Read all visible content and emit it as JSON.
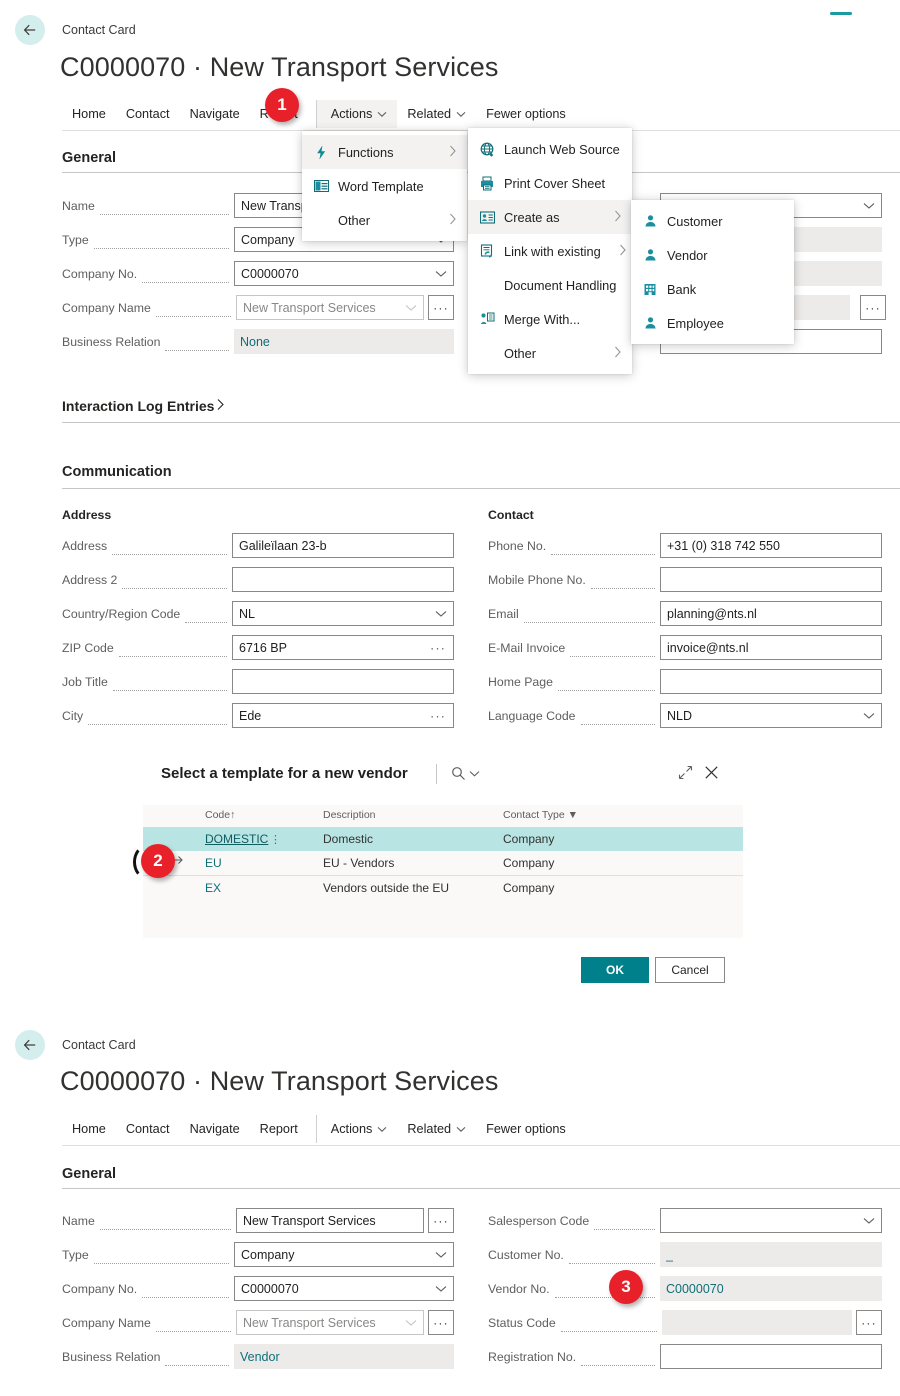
{
  "card_top": {
    "breadcrumb": "Contact Card",
    "title": "C0000070 · New Transport Services",
    "back_icon": "back-arrow-icon",
    "menu": [
      {
        "label": "Home"
      },
      {
        "label": "Contact"
      },
      {
        "label": "Navigate"
      },
      {
        "label": "Report"
      },
      {
        "label": "Actions",
        "caret": "⌄"
      },
      {
        "label": "Related",
        "caret": "⌄"
      },
      {
        "label": "Fewer options"
      }
    ],
    "general_heading": "General",
    "interaction_log_link": "Interaction Log Entries",
    "communication_heading": "Communication",
    "address_subhead": "Address",
    "contact_subhead": "Contact",
    "fields_left": [
      {
        "label": "Name",
        "value": "New Transport Services",
        "kind": "text"
      },
      {
        "label": "Type",
        "value": "Company",
        "kind": "dropdown"
      },
      {
        "label": "Company No.",
        "value": "C0000070",
        "kind": "dropdown"
      },
      {
        "label": "Company Name",
        "value": "New Transport Services",
        "kind": "ghost-dropdown-ellipsis"
      },
      {
        "label": "Business Relation",
        "value": "None",
        "kind": "readonly"
      }
    ],
    "address_fields": [
      {
        "label": "Address",
        "value": "Galileïlaan 23-b",
        "kind": "text"
      },
      {
        "label": "Address 2",
        "value": "",
        "kind": "text"
      },
      {
        "label": "Country/Region Code",
        "value": "NL",
        "kind": "dropdown"
      },
      {
        "label": "ZIP Code",
        "value": "6716 BP",
        "kind": "ellipsis"
      },
      {
        "label": "Job Title",
        "value": "",
        "kind": "text"
      },
      {
        "label": "City",
        "value": "Ede",
        "kind": "ellipsis"
      }
    ],
    "contact_fields": [
      {
        "label": "Phone No.",
        "value": "+31 (0) 318 742 550",
        "kind": "text"
      },
      {
        "label": "Mobile Phone No.",
        "value": "",
        "kind": "text"
      },
      {
        "label": "Email",
        "value": "planning@nts.nl",
        "kind": "text"
      },
      {
        "label": "E-Mail Invoice",
        "value": "invoice@nts.nl",
        "kind": "text"
      },
      {
        "label": "Home Page",
        "value": "",
        "kind": "text"
      },
      {
        "label": "Language Code",
        "value": "NLD",
        "kind": "dropdown"
      }
    ],
    "right_fields_hidden": [
      {
        "value": "",
        "kind": "dropdown"
      },
      {
        "value": "",
        "kind": "readonly"
      },
      {
        "value": "",
        "kind": "readonly"
      },
      {
        "value": "",
        "kind": "readonly-ellipsis"
      },
      {
        "value": "",
        "kind": "text"
      }
    ]
  },
  "actions_menu": {
    "items": [
      {
        "label": "Functions",
        "icon": "lightning-icon",
        "arrow": "›",
        "selected": true
      },
      {
        "label": "Word Template",
        "icon": "word-doc-icon",
        "arrow": ""
      },
      {
        "label": "Other",
        "icon": "",
        "arrow": "›"
      }
    ]
  },
  "functions_menu": {
    "items": [
      {
        "label": "Launch Web Source",
        "icon": "globe-icon",
        "arrow": ""
      },
      {
        "label": "Print Cover Sheet",
        "icon": "printer-icon",
        "arrow": ""
      },
      {
        "label": "Create as",
        "icon": "contact-card-icon",
        "arrow": "›",
        "selected": true
      },
      {
        "label": "Link with existing",
        "icon": "link-icon",
        "arrow": "›"
      },
      {
        "label": "Document Handling",
        "icon": "",
        "arrow": ""
      },
      {
        "label": "Merge With...",
        "icon": "merge-icon",
        "arrow": ""
      },
      {
        "label": "Other",
        "icon": "",
        "arrow": "›"
      }
    ]
  },
  "create_as_menu": {
    "items": [
      {
        "label": "Customer",
        "icon": "person-icon"
      },
      {
        "label": "Vendor",
        "icon": "person-icon"
      },
      {
        "label": "Bank",
        "icon": "bank-icon"
      },
      {
        "label": "Employee",
        "icon": "person-icon"
      }
    ]
  },
  "dialog": {
    "title": "Select a template for a new vendor",
    "search_icon": "search-icon",
    "search_caret": "⌄",
    "expand_icon": "expand-icon",
    "close_icon": "close-icon",
    "columns": [
      {
        "label": "Code",
        "sort": "↑"
      },
      {
        "label": "Description",
        "sort": ""
      },
      {
        "label": "Contact Type",
        "filter": "▼"
      }
    ],
    "rows": [
      {
        "code": "DOMESTIC",
        "description": "Domestic",
        "contact_type": "Company",
        "selected": true,
        "kebab": "⋮"
      },
      {
        "code": "EU",
        "description": "EU - Vendors",
        "contact_type": "Company",
        "selected": false,
        "kebab": ""
      },
      {
        "code": "EX",
        "description": "Vendors outside the EU",
        "contact_type": "Company",
        "selected": false,
        "kebab": ""
      }
    ],
    "ok_label": "OK",
    "cancel_label": "Cancel"
  },
  "card_bottom": {
    "breadcrumb": "Contact Card",
    "title": "C0000070 · New Transport Services",
    "back_icon": "back-arrow-icon",
    "menu": [
      {
        "label": "Home"
      },
      {
        "label": "Contact"
      },
      {
        "label": "Navigate"
      },
      {
        "label": "Report"
      },
      {
        "label": "Actions",
        "caret": "⌄"
      },
      {
        "label": "Related",
        "caret": "⌄"
      },
      {
        "label": "Fewer options"
      }
    ],
    "general_heading": "General",
    "fields_left": [
      {
        "label": "Name",
        "value": "New Transport Services",
        "kind": "text-ellipsis"
      },
      {
        "label": "Type",
        "value": "Company",
        "kind": "dropdown"
      },
      {
        "label": "Company No.",
        "value": "C0000070",
        "kind": "dropdown"
      },
      {
        "label": "Company Name",
        "value": "New Transport Services",
        "kind": "ghost-dropdown-ellipsis"
      },
      {
        "label": "Business Relation",
        "value": "Vendor",
        "kind": "readonly"
      }
    ],
    "fields_right": [
      {
        "label": "Salesperson Code",
        "value": "",
        "kind": "dropdown"
      },
      {
        "label": "Customer No.",
        "value": "_",
        "kind": "readonly"
      },
      {
        "label": "Vendor No.",
        "value": "C0000070",
        "kind": "readonly"
      },
      {
        "label": "Status Code",
        "value": "",
        "kind": "readonly-ellipsis"
      },
      {
        "label": "Registration No.",
        "value": "",
        "kind": "text"
      }
    ]
  },
  "badges": [
    {
      "number": "1"
    },
    {
      "number": "2"
    },
    {
      "number": "3"
    }
  ],
  "colors": {
    "accent_teal": "#00808a",
    "badge_red": "#e8202a",
    "row_selected": "#b8e5e3",
    "readonly_bg": "#edebe9",
    "back_circle": "#d4eded"
  }
}
